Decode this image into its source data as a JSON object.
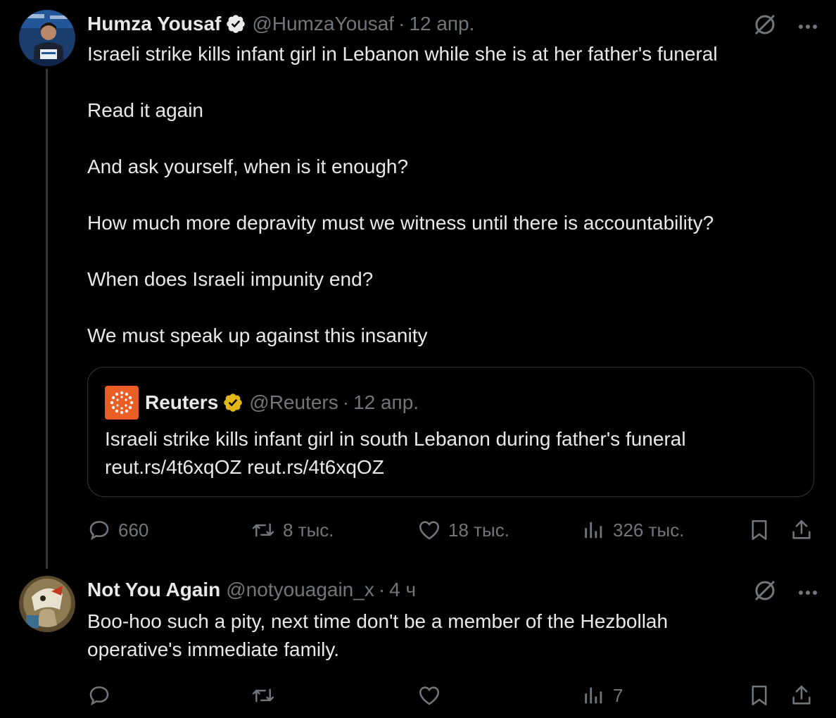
{
  "tweet": {
    "author_name": "Humza Yousaf",
    "handle": "@HumzaYousaf",
    "separator": "·",
    "time": "12 апр.",
    "body": "Israeli strike kills infant girl in Lebanon while she is at her father's funeral\n\nRead it again\n\nAnd ask yourself, when is it enough?\n\nHow much more depravity must we witness until there is accountability?\n\nWhen does Israeli impunity end?\n\nWe must speak up against this insanity",
    "quote": {
      "author_name": "Reuters",
      "handle": "@Reuters",
      "separator": "·",
      "time": "12 апр.",
      "body": "Israeli strike kills infant girl in south Lebanon during father's funeral\nreut.rs/4t6xqOZ reut.rs/4t6xqOZ"
    },
    "stats": {
      "replies": "660",
      "reposts": "8 тыс.",
      "likes": "18 тыс.",
      "views": "326 тыс."
    }
  },
  "reply": {
    "author_name": "Not You Again",
    "handle": "@notyouagain_x",
    "separator": "·",
    "time": "4 ч",
    "body": "Boo-hoo such a pity, next time don't be a member of the Hezbollah\noperative's immediate family.",
    "stats": {
      "views": "7"
    }
  },
  "colors": {
    "background": "#000000",
    "text": "#e7e9ea",
    "secondary": "#71767b",
    "verified_blue": "#1d9bf0",
    "verified_gold": "#e2b719",
    "reuters_orange": "#e85e24",
    "border": "#333639"
  },
  "icons": [
    "verified-badge-icon",
    "gold-verified-badge-icon",
    "grok-icon",
    "more-icon",
    "reply-icon",
    "repost-icon",
    "like-icon",
    "views-icon",
    "bookmark-icon",
    "share-icon"
  ]
}
